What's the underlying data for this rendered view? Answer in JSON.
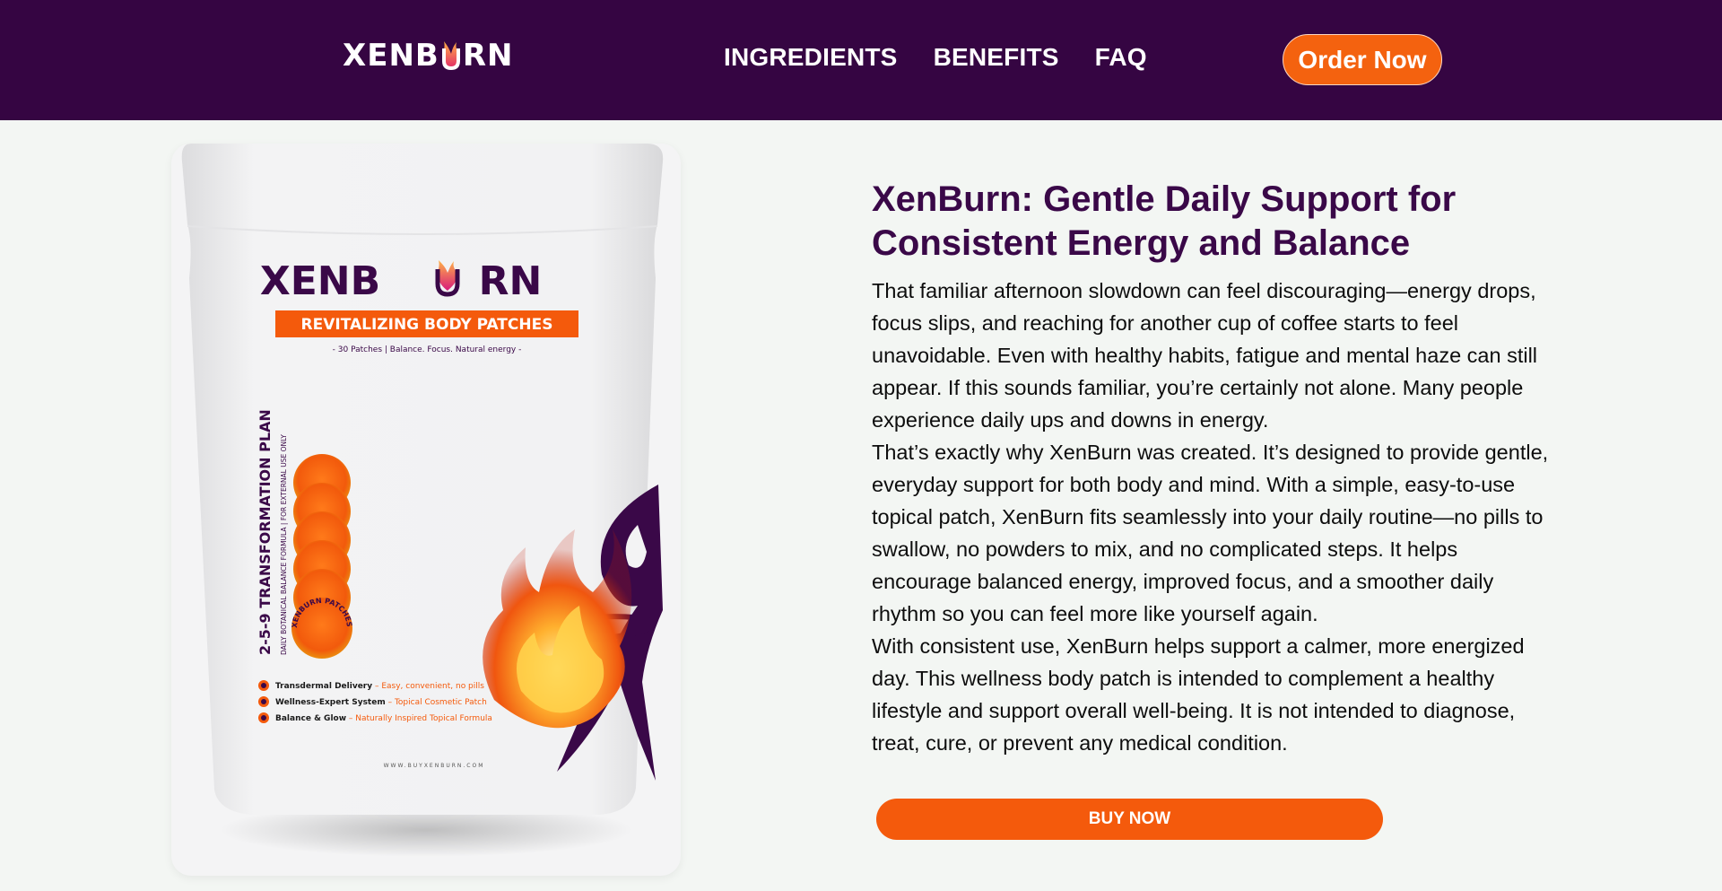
{
  "header": {
    "logo_text_left": "XENB",
    "logo_text_right": "RN",
    "nav": [
      {
        "label": "INGREDIENTS"
      },
      {
        "label": "BENEFITS"
      },
      {
        "label": "FAQ"
      }
    ],
    "cta_label": "Order Now"
  },
  "product": {
    "brand_left": "XENB",
    "brand_right": "RN",
    "banner": "REVITALIZING BODY PATCHES",
    "tagline": "- 30 Patches | Balance. Focus. Natural energy -",
    "side_title": "2-5-9 TRANSFORMATION PLAN",
    "side_subtitle": "DAILY BOTANICAL BALANCE FORMULA | FOR EXTERNAL USE ONLY",
    "patch_text": "XENBURN PATCHES",
    "features": [
      {
        "name": "Transdermal Delivery",
        "detail": " – Easy, convenient, no pills"
      },
      {
        "name": "Wellness-Expert System",
        "detail": " – Topical Cosmetic Patch"
      },
      {
        "name": "Balance & Glow",
        "detail": " – Naturally Inspired Topical Formula"
      }
    ],
    "url": "WWW.BUYXENBURN.COM"
  },
  "main": {
    "title": "XenBurn: Gentle Daily Support for Consistent Energy and Balance",
    "paragraphs": [
      "That familiar afternoon slowdown can feel discouraging—energy drops, focus slips, and reaching for another cup of coffee starts to feel unavoidable. Even with healthy habits, fatigue and mental haze can still appear. If this sounds familiar, you’re certainly not alone. Many people experience daily ups and downs in energy.",
      "That’s exactly why XenBurn was created. It’s designed to provide gentle, everyday support for both body and mind. With a simple, easy-to-use topical patch, XenBurn fits seamlessly into your daily routine—no pills to swallow, no powders to mix, and no complicated steps. It helps encourage balanced energy, improved focus, and a smoother daily rhythm so you can feel more like yourself again.",
      "With consistent use, XenBurn helps support a calmer, more energized day. This wellness body patch is intended to complement a healthy lifestyle and support overall well-being. It is not intended to diagnose, treat, cure, or prevent any medical condition."
    ],
    "buy_label": "BUY NOW"
  },
  "colors": {
    "header_bg": "#350542",
    "accent_orange": "#f4620f",
    "title_purple": "#3a0848",
    "page_bg": "#f3f6f3"
  },
  "icons": [
    "flame-icon",
    "fire-illustration",
    "figure-silhouette"
  ]
}
